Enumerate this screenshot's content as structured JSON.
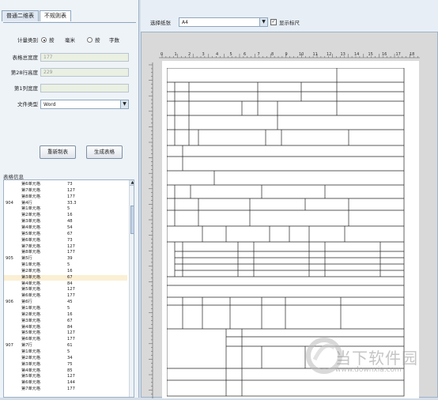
{
  "tabs": [
    "普通二维表",
    "不规则表"
  ],
  "form": {
    "unit_label": "计量类别",
    "unit_opt1_pre": "按",
    "unit_opt1": "毫米",
    "unit_opt2_pre": "按",
    "unit_opt2": "字数",
    "total_width_label": "表格总宽度",
    "total_width_value": "177",
    "row_height_label": "第28行高度",
    "row_height_value": "229",
    "col_width_label": "第1列宽度",
    "col_width_value": "",
    "file_type_label": "文件类型",
    "file_type_value": "Word"
  },
  "buttons": {
    "redraw": "重新制表",
    "generate": "生成表格"
  },
  "info_label": "表格信息",
  "list_rows": [
    {
      "c1": "",
      "c2": "第6单元格",
      "c3": "73"
    },
    {
      "c1": "",
      "c2": "第7单元格",
      "c3": "127"
    },
    {
      "c1": "",
      "c2": "第8单元格",
      "c3": "177"
    },
    {
      "c1": "904",
      "c2": "第4行",
      "c3": "33.3"
    },
    {
      "c1": "",
      "c2": "第1单元格",
      "c3": "5"
    },
    {
      "c1": "",
      "c2": "第2单元格",
      "c3": "16"
    },
    {
      "c1": "",
      "c2": "第3单元格",
      "c3": "48"
    },
    {
      "c1": "",
      "c2": "第4单元格",
      "c3": "54"
    },
    {
      "c1": "",
      "c2": "第5单元格",
      "c3": "67"
    },
    {
      "c1": "",
      "c2": "第6单元格",
      "c3": "73"
    },
    {
      "c1": "",
      "c2": "第7单元格",
      "c3": "127"
    },
    {
      "c1": "",
      "c2": "第8单元格",
      "c3": "177"
    },
    {
      "c1": "905",
      "c2": "第5行",
      "c3": "39"
    },
    {
      "c1": "",
      "c2": "第1单元格",
      "c3": "5"
    },
    {
      "c1": "",
      "c2": "第2单元格",
      "c3": "16"
    },
    {
      "c1": "",
      "c2": "第3单元格",
      "c3": "67"
    },
    {
      "c1": "",
      "c2": "第4单元格",
      "c3": "84"
    },
    {
      "c1": "",
      "c2": "第5单元格",
      "c3": "127"
    },
    {
      "c1": "",
      "c2": "第6单元格",
      "c3": "177"
    },
    {
      "c1": "906",
      "c2": "第6行",
      "c3": "45"
    },
    {
      "c1": "",
      "c2": "第1单元格",
      "c3": "5"
    },
    {
      "c1": "",
      "c2": "第2单元格",
      "c3": "16"
    },
    {
      "c1": "",
      "c2": "第3单元格",
      "c3": "67"
    },
    {
      "c1": "",
      "c2": "第4单元格",
      "c3": "84"
    },
    {
      "c1": "",
      "c2": "第5单元格",
      "c3": "127"
    },
    {
      "c1": "",
      "c2": "第6单元格",
      "c3": "177"
    },
    {
      "c1": "907",
      "c2": "第7行",
      "c3": "61"
    },
    {
      "c1": "",
      "c2": "第1单元格",
      "c3": "5"
    },
    {
      "c1": "",
      "c2": "第2单元格",
      "c3": "34"
    },
    {
      "c1": "",
      "c2": "第3单元格",
      "c3": "75"
    },
    {
      "c1": "",
      "c2": "第4单元格",
      "c3": "85"
    },
    {
      "c1": "",
      "c2": "第5单元格",
      "c3": "127"
    },
    {
      "c1": "",
      "c2": "第6单元格",
      "c3": "144"
    },
    {
      "c1": "",
      "c2": "第7单元格",
      "c3": "177"
    }
  ],
  "right": {
    "paper_label": "选择纸张",
    "paper_value": "A4",
    "ruler_label": "显示标尺",
    "ruler_checked": true
  },
  "ruler_nums": [
    "0",
    "1",
    "2",
    "3",
    "4",
    "5",
    "6",
    "7",
    "8",
    "9",
    "10",
    "11",
    "12",
    "13",
    "14",
    "15",
    "16",
    "17",
    "18"
  ],
  "watermark": {
    "title": "当下软件园",
    "url": "www.downxia.com"
  }
}
